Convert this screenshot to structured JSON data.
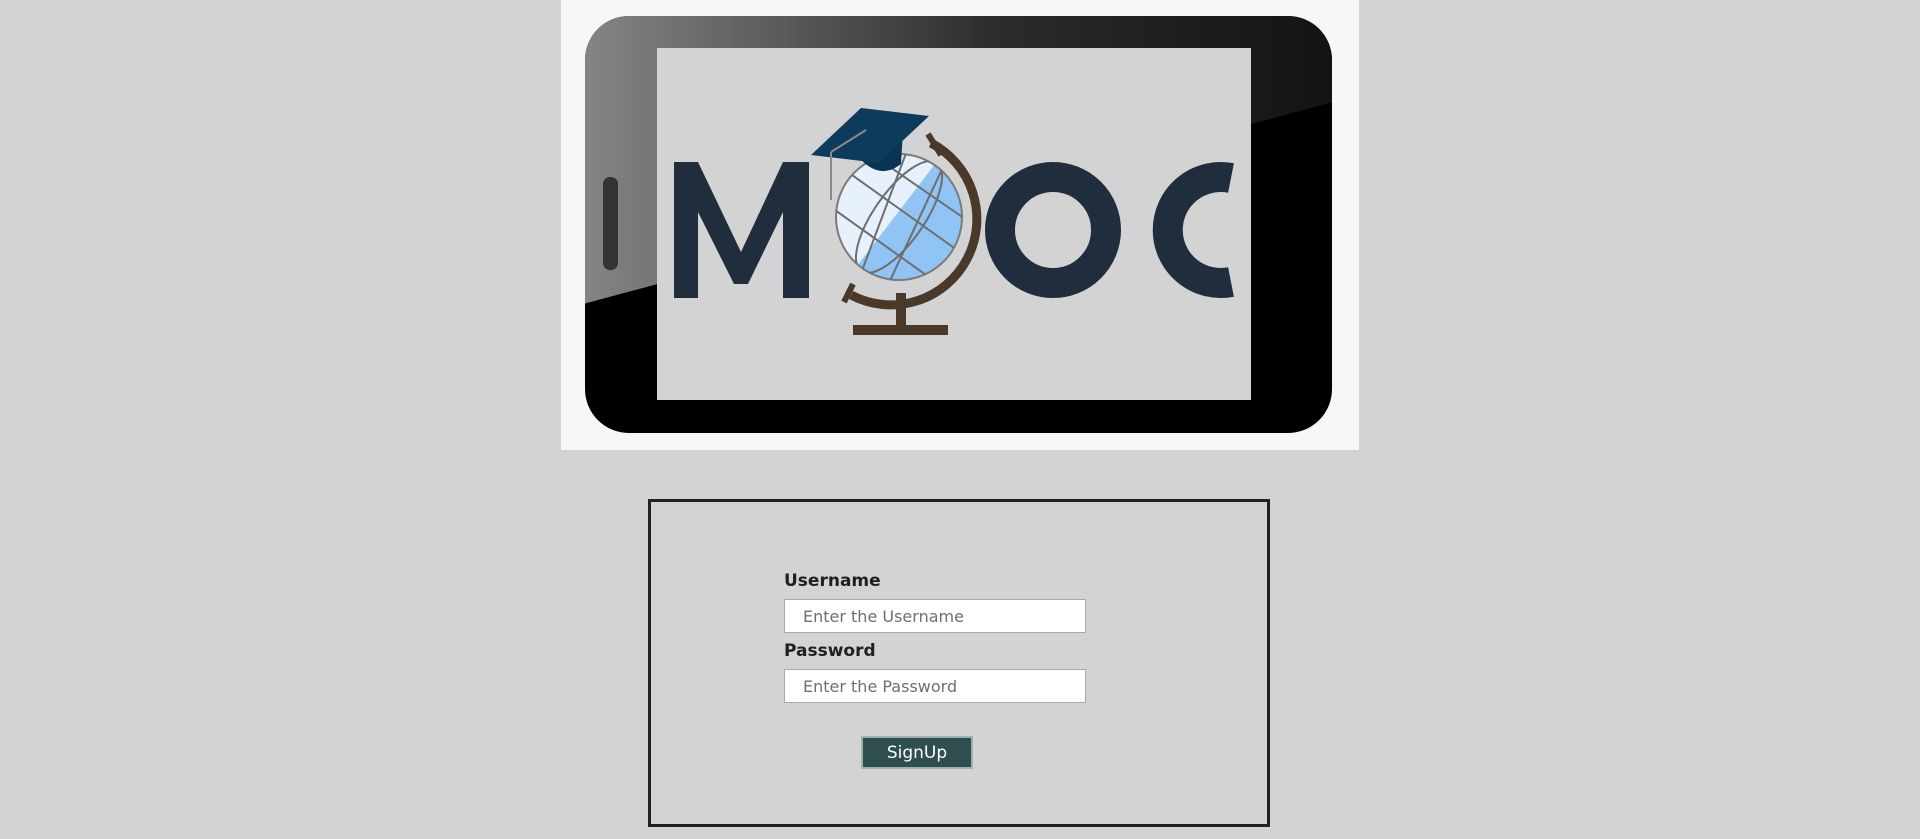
{
  "logo": {
    "letters": [
      "M",
      "O",
      "C"
    ],
    "text": "MOOC",
    "colors": {
      "letters": "#1f2d3d",
      "phone_frame": "#000000",
      "screen": "#d3d3d3",
      "cap": "#0d3b5c",
      "globe_stand": "#4a3828",
      "globe_ocean": "#90c4f5",
      "globe_light": "#e6f1fc"
    },
    "icons": [
      "smartphone-icon",
      "graduation-cap-icon",
      "globe-icon"
    ]
  },
  "login": {
    "username_label": "Username",
    "username_placeholder": "Enter the Username",
    "username_value": "",
    "password_label": "Password",
    "password_placeholder": "Enter the Password",
    "password_value": "",
    "signup_label": "SignUp",
    "button_color": "#2f4f4f"
  }
}
